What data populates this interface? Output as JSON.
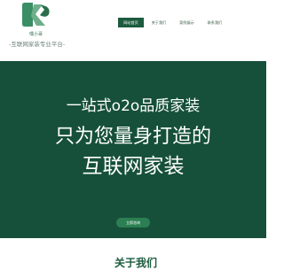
{
  "header": {
    "logo": {
      "icon": "ks-logo-icon",
      "name": "嘿小哥",
      "slogan": "-互联网家装专业平台-"
    },
    "nav": [
      {
        "label": "网站首页",
        "active": true
      },
      {
        "label": "关于我们",
        "active": false
      },
      {
        "label": "案例展示",
        "active": false
      },
      {
        "label": "联系我们",
        "active": false
      }
    ]
  },
  "hero": {
    "line1": "一站式o2o品质家装",
    "line2": "只为您量身打造的",
    "line3": "互联网家装",
    "button_label": "立即咨询"
  },
  "section": {
    "partial_heading": "关于我们"
  },
  "colors": {
    "brand_green": "#16503a",
    "button_green": "#2b7f52",
    "header_bg": "#ffffff"
  }
}
